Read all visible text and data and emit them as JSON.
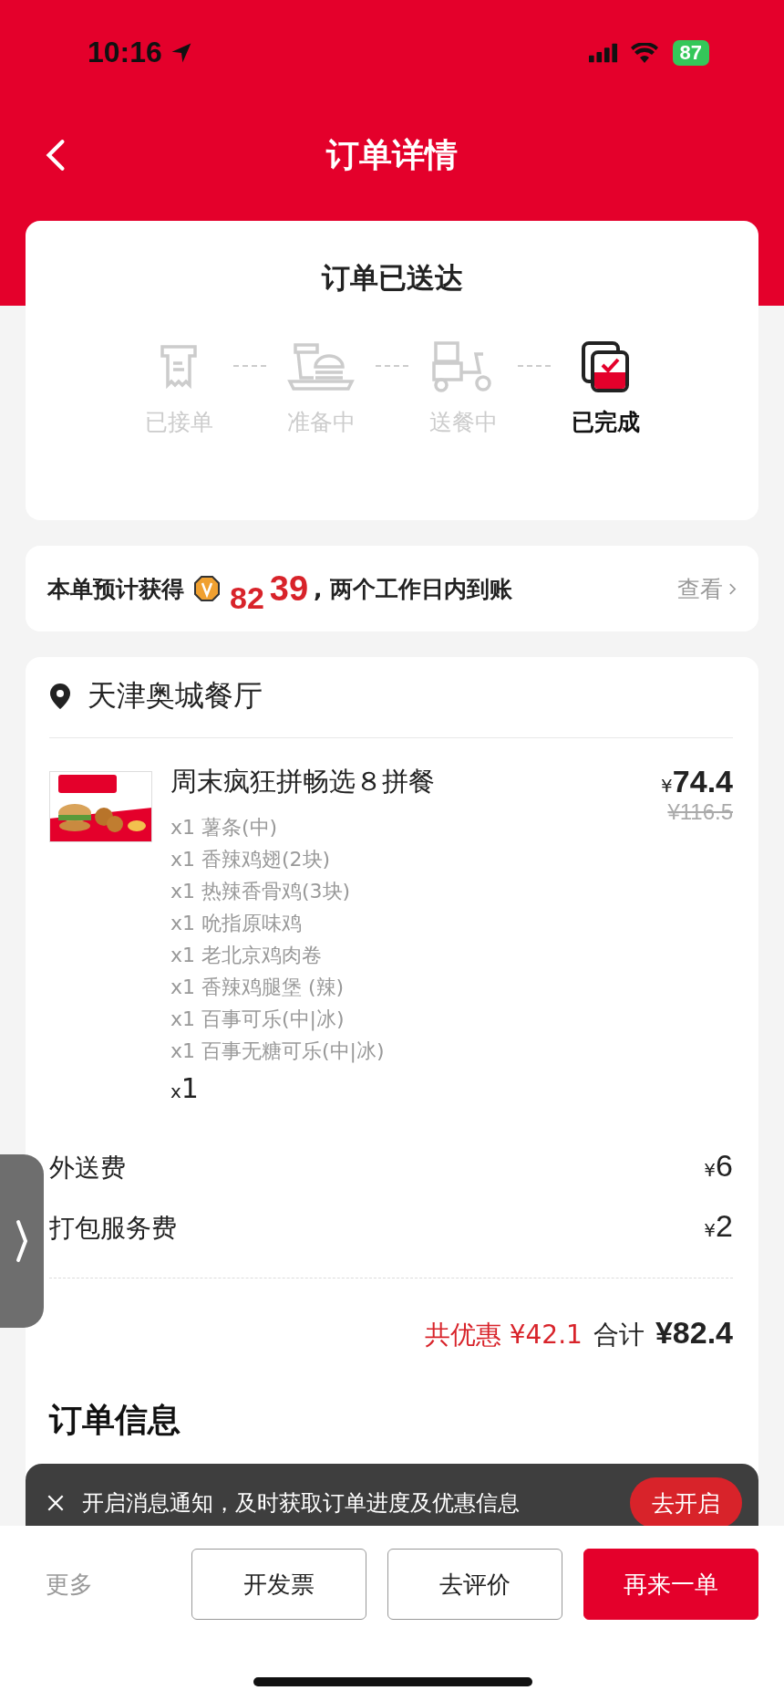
{
  "status_bar": {
    "time": "10:16",
    "battery": "87"
  },
  "header": {
    "title": "订单详情"
  },
  "status_card": {
    "title": "订单已送达",
    "steps": [
      {
        "kind": "receipt",
        "label": "已接单",
        "selected": false
      },
      {
        "kind": "meal",
        "label": "准备中",
        "selected": false
      },
      {
        "kind": "scooter",
        "label": "送餐中",
        "selected": false
      },
      {
        "kind": "done",
        "label": "已完成",
        "selected": true
      }
    ]
  },
  "points": {
    "prefix": "本单预计获得",
    "rolling": "82",
    "value": "39",
    "suffix": ", 两个工作日内到账",
    "link": "查看"
  },
  "store": {
    "name": "天津奥城餐厅",
    "items": [
      {
        "kind": "picture",
        "title": "周末疯狂拼畅选８拼餐",
        "currency": "¥",
        "price": "74.4",
        "original_price": "¥116.5",
        "options": [
          "x1 薯条(中)",
          "x1 香辣鸡翅(2块)",
          "x1 热辣香骨鸡(3块)",
          "x1 吮指原味鸡",
          "x1 老北京鸡肉卷",
          "x1 香辣鸡腿堡 (辣)",
          "x1 百事可乐(中|冰)",
          "x1 百事无糖可乐(中|冰)"
        ],
        "qty_prefix": "x",
        "qty": "1"
      }
    ],
    "fees": [
      {
        "label": "外送费",
        "currency": "¥",
        "amount": "6"
      },
      {
        "label": "打包服务费",
        "currency": "¥",
        "amount": "2"
      }
    ],
    "discount": "共优惠 ¥42.1",
    "total_label": "合计",
    "total": "¥82.4"
  },
  "section_title": "订单信息",
  "toast": {
    "text": "开启消息通知，及时获取订单进度及优惠信息",
    "button": "去开启"
  },
  "actions": {
    "more": "更多",
    "buttons": [
      {
        "label": "开发票",
        "kind": "outline"
      },
      {
        "label": "去评价",
        "kind": "outline"
      },
      {
        "label": "再来一单",
        "kind": "primary"
      }
    ]
  }
}
